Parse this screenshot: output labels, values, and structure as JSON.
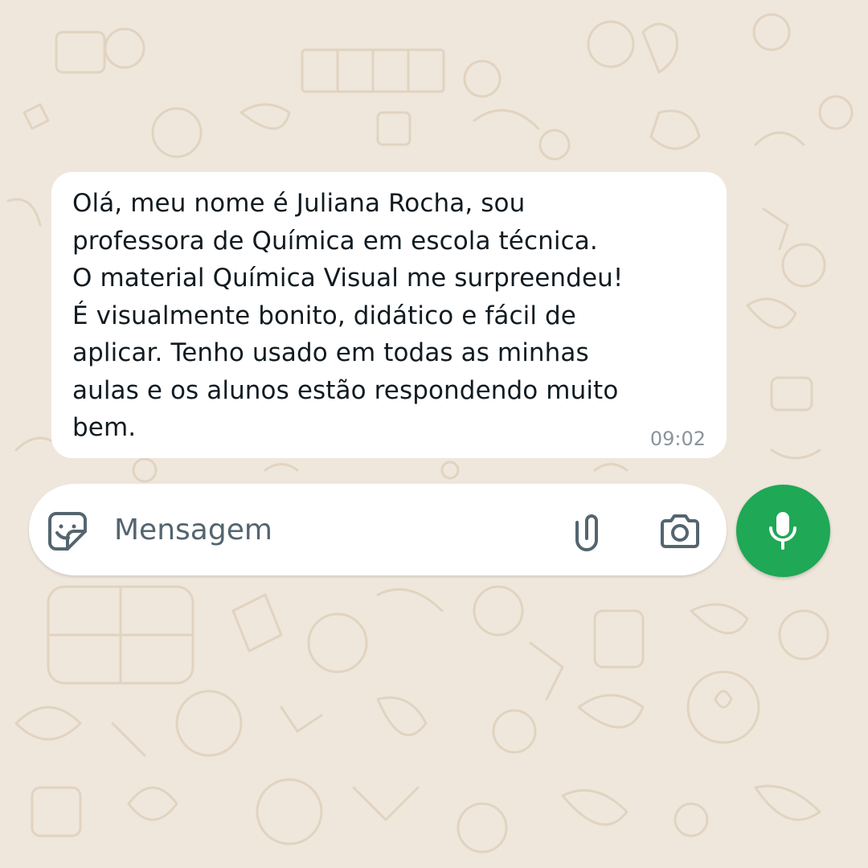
{
  "chat": {
    "message": {
      "text": "Olá, meu nome é Juliana Rocha, sou\nprofessora de Química em escola técnica.\nO material Química Visual me surpreendeu!\nÉ visualmente bonito, didático e fácil de\naplicar. Tenho usado em todas as minhas\naulas e os alunos estão respondendo muito\nbem.",
      "time": "09:02"
    }
  },
  "composer": {
    "placeholder": "Mensagem",
    "value": "",
    "icons": {
      "emoji": "sticker-emoji-icon",
      "attach": "paperclip-icon",
      "camera": "camera-icon",
      "mic": "microphone-icon"
    }
  },
  "colors": {
    "wallpaper": "#efe7dc",
    "wallpaper_doodle": "#e3d4c2",
    "bubble": "#ffffff",
    "text": "#111b21",
    "timestamp": "#8b949a",
    "icon": "#54656f",
    "mic_button": "#1fa855"
  }
}
